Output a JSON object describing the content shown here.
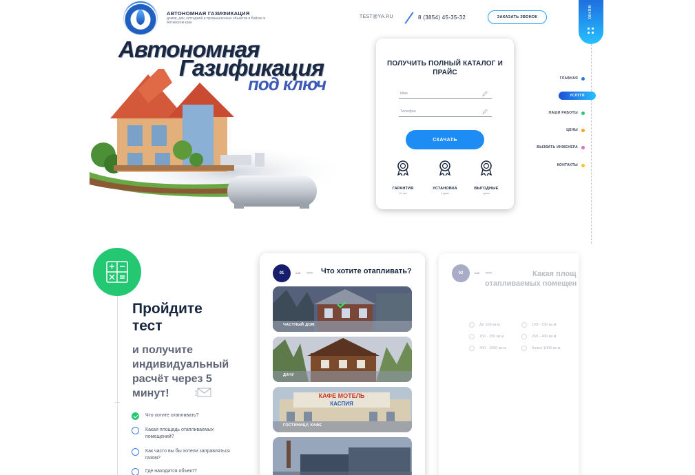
{
  "header": {
    "brand_title": "АВТОНОМНАЯ ГАЗИФИКАЦИЯ",
    "brand_subtitle": "домов, дач, коттеджей и промышленных объектов в Бийске и Алтайском крае",
    "email": "TEST@YA.RU",
    "phone": "8 (3854) 45-35-32",
    "callback_label": "ЗАКАЗАТЬ ЗВОНОК"
  },
  "menu_tab": {
    "label": "МЕНЮ"
  },
  "sidenav": {
    "items": [
      {
        "label": "ГЛАВНАЯ",
        "color": "#2a7ad6"
      },
      {
        "label": "УСЛУГИ",
        "color": "#27c0ff",
        "active": true
      },
      {
        "label": "НАШИ РАБОТЫ",
        "color": "#24c873"
      },
      {
        "label": "ЦЕНЫ",
        "color": "#f5a623"
      },
      {
        "label": "ВЫЗВАТЬ ИНЖЕНЕРА",
        "color": "#d66ad6"
      },
      {
        "label": "КОНТАКТЫ",
        "color": "#f5c623"
      }
    ]
  },
  "hero": {
    "line1": "Автономная",
    "line2": "Газификация",
    "line3": "под ключ"
  },
  "form": {
    "title": "ПОЛУЧИТЬ ПОЛНЫЙ КАТАЛОГ И ПРАЙС",
    "name_placeholder": "Имя",
    "phone_placeholder": "Телефон",
    "submit_label": "СКАЧАТЬ",
    "features": [
      {
        "title": "ГАРАНТИЯ",
        "subtitle": "10 лет",
        "icon": "award-icon"
      },
      {
        "title": "УСТАНОВКА",
        "subtitle": "1 день",
        "icon": "award-icon"
      },
      {
        "title": "ВЫГОДНЫЕ",
        "subtitle": "цены",
        "icon": "award-icon"
      }
    ]
  },
  "quiz": {
    "heading": "Пройдите тест",
    "subheading": "и получите индивидуальный расчёт через 5 минут!",
    "steps": [
      {
        "label": "Что хотите отапливать?",
        "done": true
      },
      {
        "label": "Какая площадь отапливаемых помещений?",
        "done": false
      },
      {
        "label": "Как часто вы бы хотели заправляться газом?",
        "done": false
      },
      {
        "label": "Где находится объект?",
        "done": false
      }
    ],
    "card1": {
      "step_number": "01",
      "step_word": "шаг",
      "question": "Что хотите отапливать?",
      "options": [
        {
          "label": "ЧАСТНЫЙ ДОМ",
          "selected": true
        },
        {
          "label": "ДАЧУ",
          "selected": false
        },
        {
          "label": "ГОСТИНИЦУ, КАФЕ",
          "selected": false
        },
        {
          "label": "",
          "selected": false
        }
      ],
      "sign_line1": "КАФЕ  МОТЕЛЬ",
      "sign_line2": "КАСПИЯ"
    },
    "card2": {
      "step_number": "02",
      "step_word": "шаг",
      "question_line1": "Какая площ",
      "question_line2": "отапливаемых помещен",
      "options": [
        "До 100 кв.м",
        "100 - 150 кв.м",
        "150 - 250 кв.м",
        "250 - 400 кв.м",
        "400 - 1000 кв.м",
        "более 1000 кв.м"
      ]
    }
  }
}
